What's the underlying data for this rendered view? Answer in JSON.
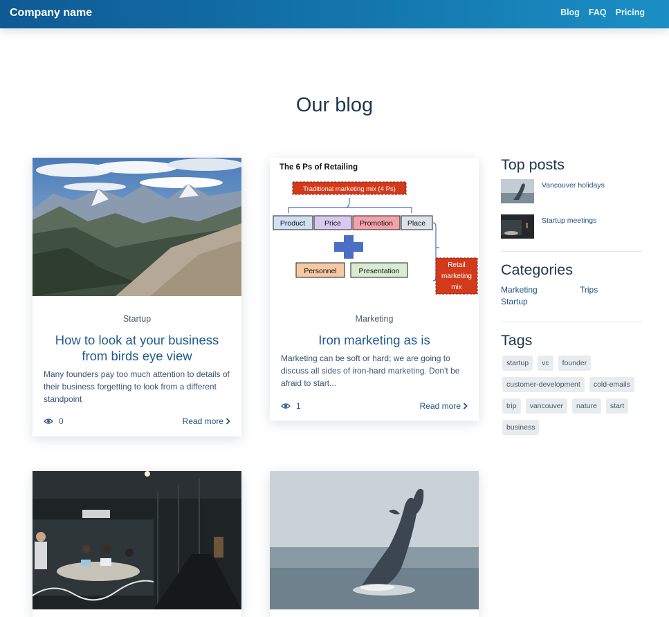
{
  "nav": {
    "brand": "Company name",
    "links": [
      "Blog",
      "FAQ",
      "Pricing"
    ]
  },
  "page": {
    "title": "Our blog"
  },
  "posts": [
    {
      "category": "Startup",
      "title": "How to look at your business from birds eye view",
      "excerpt": "Many founders pay too much attention to details of their business forgetting to look from a different standpoint",
      "views": "0",
      "read_more": "Read more"
    },
    {
      "category": "Marketing",
      "title": "Iron marketing as is",
      "excerpt": "Marketing can be soft or hard; we are going to discuss all sides of iron-hard marketing. Don't be afraid to start...",
      "views": "1",
      "read_more": "Read more"
    }
  ],
  "diagram": {
    "title": "The 6 Ps of Retailing",
    "traditional": "Traditional marketing mix (4 Ps)",
    "product": "Product",
    "price": "Price",
    "promotion": "Promotion",
    "place": "Place",
    "personnel": "Personnel",
    "presentation": "Presentation",
    "retail_1": "Retail",
    "retail_2": "marketing",
    "retail_3": "mix"
  },
  "sidebar": {
    "top_posts_heading": "Top posts",
    "top_posts": [
      "Vancouver holidays",
      "Startup meetings"
    ],
    "categories_heading": "Categories",
    "categories": [
      "Marketing",
      "Trips",
      "Startup"
    ],
    "tags_heading": "Tags",
    "tags": [
      "startup",
      "vc",
      "founder",
      "customer-development",
      "cold-emails",
      "trip",
      "vancouver",
      "nature",
      "start",
      "business"
    ]
  },
  "colors": {
    "navbar_start": "#0f5a94",
    "navbar_end": "#1a8fc4",
    "link": "#1f5a8f",
    "tag_bg": "#e9ecef"
  }
}
